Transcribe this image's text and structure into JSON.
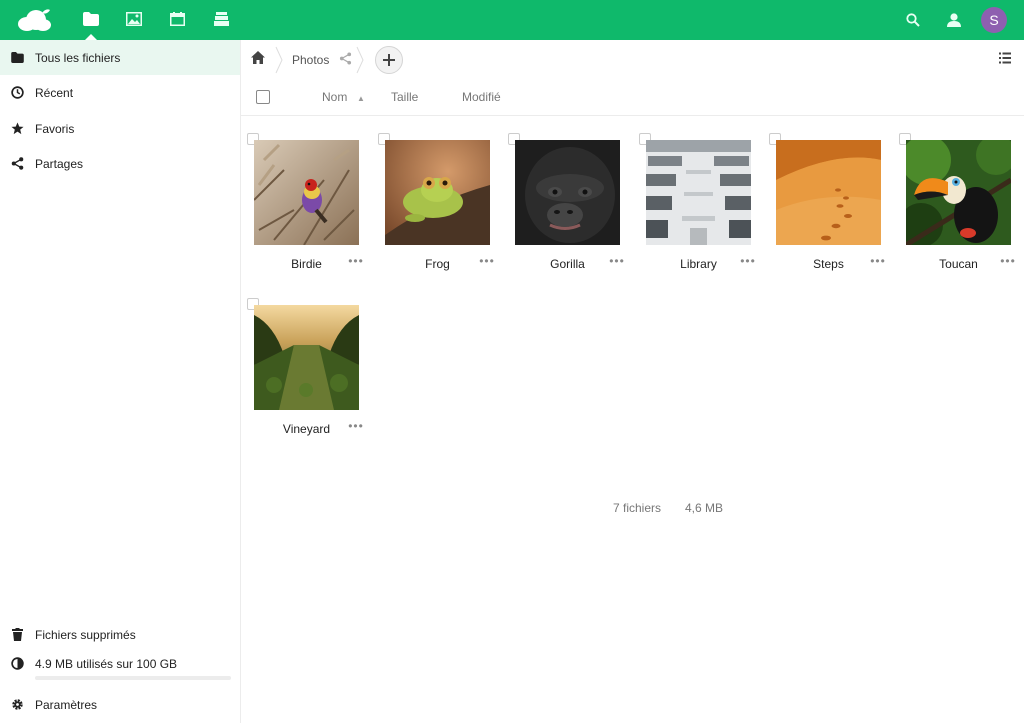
{
  "header": {
    "apps": [
      {
        "name": "files",
        "icon": "folder-icon"
      },
      {
        "name": "gallery",
        "icon": "image-icon"
      },
      {
        "name": "calendar",
        "icon": "calendar-icon"
      },
      {
        "name": "deck",
        "icon": "stack-icon"
      }
    ],
    "avatar_letter": "S",
    "avatar_color": "#8e5fb0",
    "brand_color": "#0fb96b"
  },
  "sidebar": {
    "items": [
      {
        "label": "Tous les fichiers",
        "icon": "folder-icon"
      },
      {
        "label": "Récent",
        "icon": "clock-icon"
      },
      {
        "label": "Favoris",
        "icon": "star-icon"
      },
      {
        "label": "Partages",
        "icon": "share-icon"
      }
    ],
    "deleted_label": "Fichiers supprimés",
    "quota_label": "4.9 MB utilisés sur 100 GB",
    "quota_fraction": 0.0001,
    "settings_label": "Paramètres"
  },
  "breadcrumb": {
    "folder": "Photos"
  },
  "columns": {
    "name": "Nom",
    "size": "Taille",
    "modified": "Modifié"
  },
  "files": [
    {
      "name": "Birdie",
      "thumb": "bird"
    },
    {
      "name": "Frog",
      "thumb": "frog"
    },
    {
      "name": "Gorilla",
      "thumb": "gorilla"
    },
    {
      "name": "Library",
      "thumb": "library"
    },
    {
      "name": "Steps",
      "thumb": "desert"
    },
    {
      "name": "Toucan",
      "thumb": "toucan"
    },
    {
      "name": "Vineyard",
      "thumb": "vineyard"
    }
  ],
  "summary": {
    "count": "7 fichiers",
    "size": "4,6 MB"
  },
  "more_glyph": "•••"
}
